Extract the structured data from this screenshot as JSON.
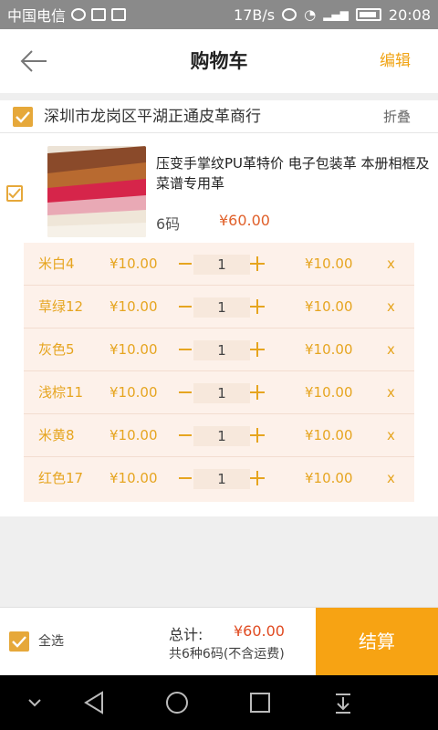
{
  "status_bar": {
    "carrier": "中国电信",
    "speed": "17B/s",
    "time": "20:08"
  },
  "header": {
    "title": "购物车",
    "edit_label": "编辑",
    "back_icon": "arrow-left-icon"
  },
  "shop": {
    "name": "深圳市龙岗区平湖正通皮革商行",
    "fold_label": "折叠",
    "checked": true
  },
  "product": {
    "name": "压变手掌纹PU革特价 电子包装革 本册相框及菜谱专用革",
    "unit": "6码",
    "price": "¥60.00",
    "checked": true
  },
  "variants": [
    {
      "color": "米白4",
      "price": "¥10.00",
      "qty": "1",
      "subtotal": "¥10.00",
      "delete": "x"
    },
    {
      "color": "草绿12",
      "price": "¥10.00",
      "qty": "1",
      "subtotal": "¥10.00",
      "delete": "x"
    },
    {
      "color": "灰色5",
      "price": "¥10.00",
      "qty": "1",
      "subtotal": "¥10.00",
      "delete": "x"
    },
    {
      "color": "浅棕11",
      "price": "¥10.00",
      "qty": "1",
      "subtotal": "¥10.00",
      "delete": "x"
    },
    {
      "color": "米黄8",
      "price": "¥10.00",
      "qty": "1",
      "subtotal": "¥10.00",
      "delete": "x"
    },
    {
      "color": "红色17",
      "price": "¥10.00",
      "qty": "1",
      "subtotal": "¥10.00",
      "delete": "x"
    }
  ],
  "footer": {
    "select_all_label": "全选",
    "total_label": "总计:",
    "total_value": "¥60.00",
    "summary": "共6种6码(不含运费)",
    "checkout_label": "结算"
  },
  "colors": {
    "accent": "#f7a313",
    "checkbox": "#e6a83a",
    "price_red": "#e0602a",
    "variant_bg": "#fdf1ea"
  }
}
